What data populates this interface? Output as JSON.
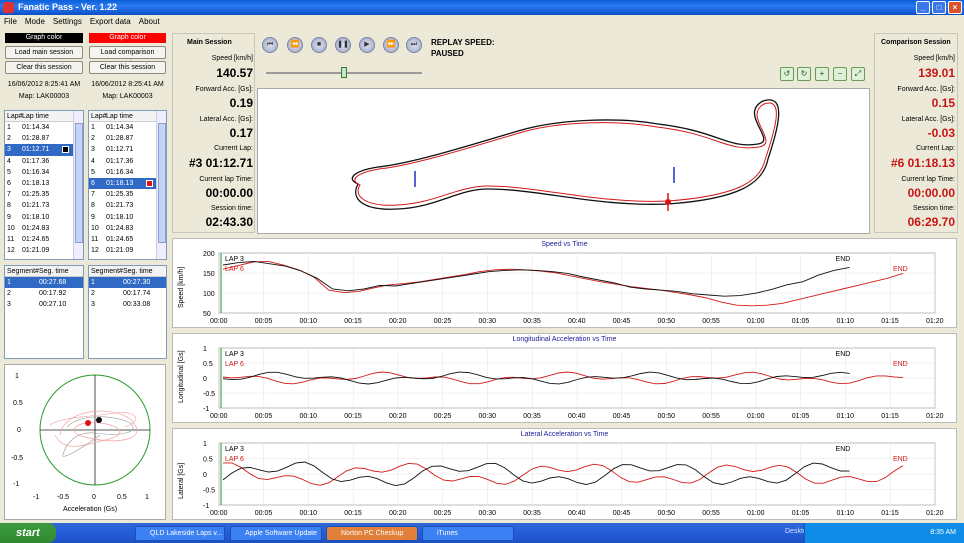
{
  "window": {
    "title": "Fanatic Pass - Ver. 1.22"
  },
  "menu": [
    "File",
    "Mode",
    "Settings",
    "Export data",
    "About"
  ],
  "left_main": {
    "color_label": "Graph color",
    "color": "#000000",
    "load": "Load main session",
    "clear": "Clear this session",
    "date": "16/06/2012 8:25:41 AM",
    "map": "Map: LAK00003"
  },
  "left_comp": {
    "color_label": "Graph color",
    "color": "#e01414",
    "load": "Load comparison session",
    "clear": "Clear this session",
    "date": "16/06/2012 8:25:41 AM",
    "map": "Map: LAK00003"
  },
  "lap_headers": [
    "Lap#",
    "Lap time"
  ],
  "main_laps": [
    [
      "1",
      "01:14.34"
    ],
    [
      "2",
      "01:28.87"
    ],
    [
      "3",
      "01:12.71"
    ],
    [
      "4",
      "01:17.36"
    ],
    [
      "5",
      "01:16.34"
    ],
    [
      "6",
      "01:18.13"
    ],
    [
      "7",
      "01:25.35"
    ],
    [
      "8",
      "01:21.73"
    ],
    [
      "9",
      "01:18.10"
    ],
    [
      "10",
      "01:24.83"
    ],
    [
      "11",
      "01:24.65"
    ],
    [
      "12",
      "01:21.09"
    ]
  ],
  "comp_laps": [
    [
      "1",
      "01:14.34"
    ],
    [
      "2",
      "01:28.87"
    ],
    [
      "3",
      "01:12.71"
    ],
    [
      "4",
      "01:17.36"
    ],
    [
      "5",
      "01:16.34"
    ],
    [
      "6",
      "01:18.13"
    ],
    [
      "7",
      "01:25.35"
    ],
    [
      "8",
      "01:21.73"
    ],
    [
      "9",
      "01:18.10"
    ],
    [
      "10",
      "01:24.83"
    ],
    [
      "11",
      "01:24.65"
    ],
    [
      "12",
      "01:21.09"
    ]
  ],
  "seg_headers": [
    "Segment#",
    "Seg. time"
  ],
  "main_segs": [
    [
      "1",
      "00:27.68"
    ],
    [
      "2",
      "00:17.92"
    ],
    [
      "3",
      "00:27.10"
    ]
  ],
  "comp_segs": [
    [
      "1",
      "00:27.30"
    ],
    [
      "2",
      "00:17.74"
    ],
    [
      "3",
      "00:33.08"
    ]
  ],
  "gg": {
    "xlabel": "Acceleration (Gs)",
    "ticks_x": [
      "-1",
      "-0.5",
      "0",
      "0.5",
      "1"
    ],
    "ticks_y": [
      "1",
      "0.5",
      "0",
      "-0.5",
      "-1"
    ]
  },
  "main_session": {
    "title": "Main Session",
    "speed_label": "Speed [km/h]",
    "speed": "140.57",
    "fwd_label": "Forward Acc. [Gs]:",
    "fwd": "0.19",
    "lat_label": "Lateral Acc. [Gs]:",
    "lat": "0.17",
    "lap_label": "Current Lap:",
    "lap": "#3 01:12.71",
    "laptime_label": "Current lap Time:",
    "laptime": "00:00.00",
    "sess_label": "Session time:",
    "sess": "02:43.30"
  },
  "comp_session": {
    "title": "Comparison Session",
    "speed_label": "Speed [km/h]",
    "speed": "139.01",
    "fwd_label": "Forward Acc. [Gs]:",
    "fwd": "0.15",
    "lat_label": "Lateral Acc. [Gs]:",
    "lat": "-0.03",
    "lap_label": "Current Lap:",
    "lap": "#6 01:18.13",
    "laptime_label": "Current lap Time:",
    "laptime": "00:00.00",
    "sess_label": "Session time:",
    "sess": "06:29.70"
  },
  "replay": {
    "label": "REPLAY SPEED:",
    "state": "PAUSED"
  },
  "time_ticks": [
    "00:00",
    "00:05",
    "00:10",
    "00:15",
    "00:20",
    "00:25",
    "00:30",
    "00:35",
    "00:40",
    "00:45",
    "00:50",
    "00:55",
    "01:00",
    "01:05",
    "01:10",
    "01:15",
    "01:20"
  ],
  "graphs": [
    {
      "title": "Speed vs Time",
      "ylabel": "Speed [km/h]",
      "yticks": [
        "200",
        "150",
        "100",
        "50"
      ],
      "legend1": "LAP 3",
      "legend2": "LAP 6",
      "end": "END"
    },
    {
      "title": "Longitudinal Acceleration vs Time",
      "ylabel": "Longitudinal [Gs]",
      "yticks": [
        "1",
        "0.5",
        "0",
        "-0.5",
        "-1"
      ],
      "legend1": "LAP 3",
      "legend2": "LAP 6",
      "end": "END"
    },
    {
      "title": "Lateral Acceleration vs Time",
      "ylabel": "Lateral [Gs]",
      "yticks": [
        "1",
        "0.5",
        "0",
        "-0.5",
        "-1"
      ],
      "legend1": "LAP 3",
      "legend2": "LAP 6",
      "end": "END"
    }
  ],
  "taskbar": {
    "start": "start",
    "tasks": [
      "QLD Lakeside Laps v...",
      "Apple Software Update",
      "Norton PC Checkup",
      "iTunes"
    ],
    "desktop": "Desktop",
    "clock": "8:35 AM"
  }
}
